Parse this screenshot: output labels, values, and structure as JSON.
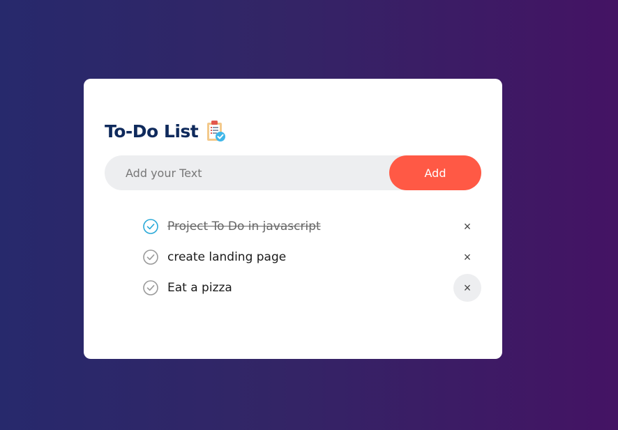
{
  "app": {
    "title": "To-Do List",
    "icon": "clipboard-check-icon"
  },
  "input": {
    "placeholder": "Add your Text",
    "value": "",
    "add_label": "Add"
  },
  "tasks": [
    {
      "text": "Project To Do in javascript",
      "done": true
    },
    {
      "text": "create landing page",
      "done": false
    },
    {
      "text": "Eat a pizza",
      "done": false
    }
  ],
  "delete_glyph": "×",
  "colors": {
    "accent": "#ff5945",
    "title": "#0f2a5c",
    "check_done": "#29a9d8",
    "check_pending": "#9a9a9a",
    "input_bg": "#edeef0"
  }
}
